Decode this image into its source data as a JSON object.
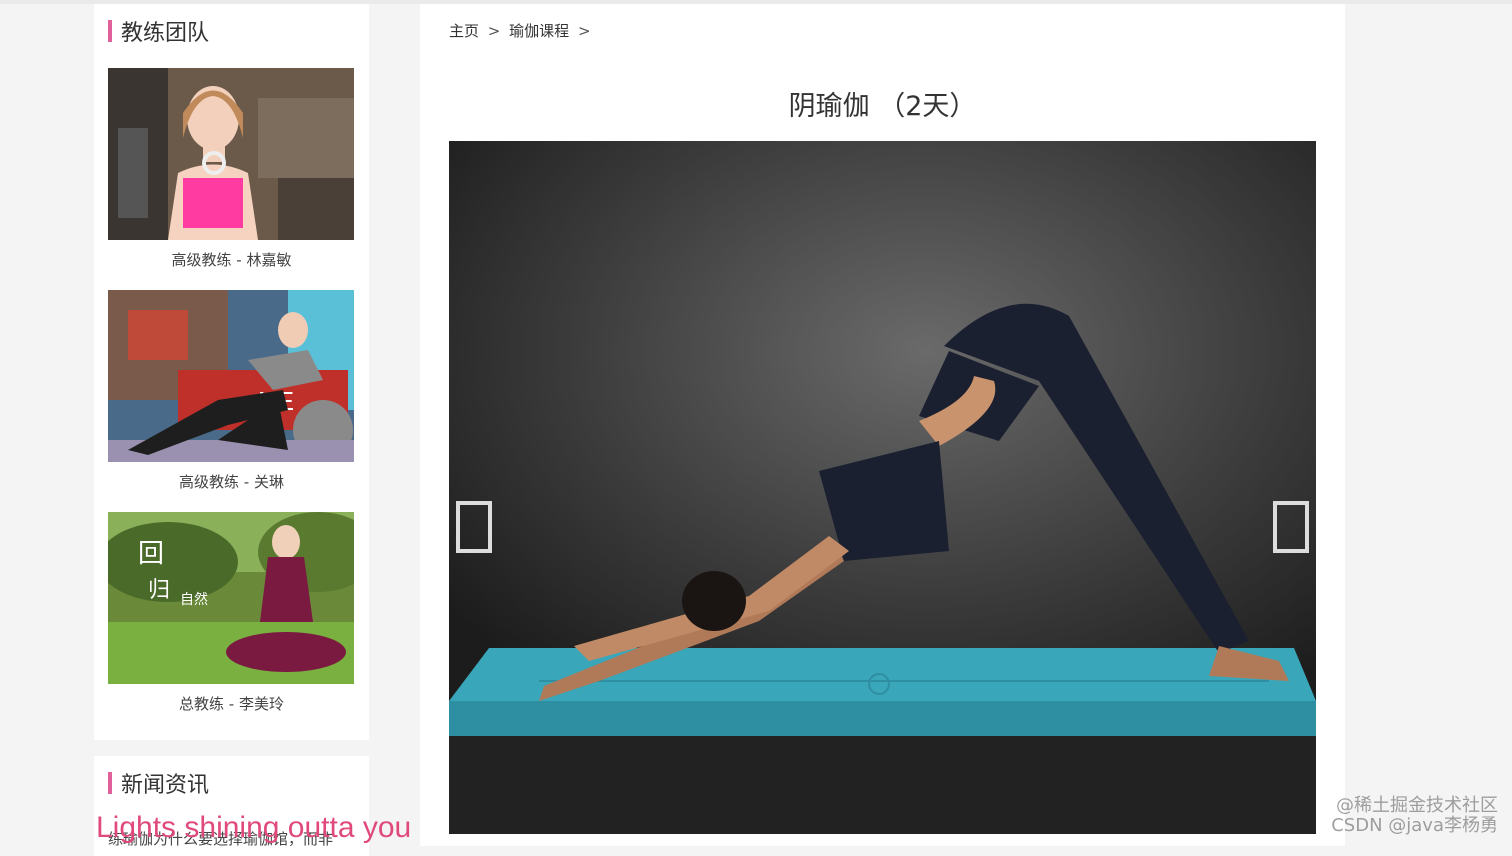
{
  "sidebar": {
    "team": {
      "title": "教练团队",
      "coaches": [
        {
          "name": "高级教练 - 林嘉敏",
          "accent": "#ff3aa0"
        },
        {
          "name": "高级教练 - 关琳",
          "accent": "#b0b0b0"
        },
        {
          "name": "总教练 - 李美玲",
          "accent": "#8a1f4a"
        }
      ]
    },
    "news": {
      "title": "新闻资讯",
      "items": [
        "练瑜伽为什么要选择瑜伽馆，而非"
      ]
    }
  },
  "breadcrumb": {
    "home": "主页",
    "separator": ">",
    "category": "瑜伽课程",
    "trailing_separator": ">"
  },
  "course": {
    "title": "阴瑜伽 （2天）"
  },
  "gallery": {
    "prev_icon": "chevron-left-icon",
    "next_icon": "chevron-right-icon",
    "image": "yoga-downward-dog-photo"
  },
  "overlay": {
    "lyric": "Lights shining outta you"
  },
  "watermark": {
    "line1": "@稀土掘金技术社区",
    "line2": "CSDN @java李杨勇"
  },
  "colors": {
    "accent": "#e0609a",
    "mat": "#3aa6b9"
  }
}
